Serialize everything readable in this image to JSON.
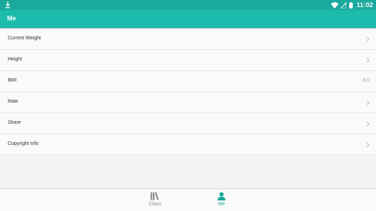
{
  "status_bar": {
    "time": "11:02",
    "icons": [
      "download-icon",
      "wifi-icon",
      "signal-icon",
      "battery-icon"
    ]
  },
  "app_bar": {
    "title": "Me"
  },
  "settings": {
    "items": [
      {
        "label": "Current Weight",
        "icon": "chevron-right-icon"
      },
      {
        "label": "Height",
        "icon": "chevron-right-icon"
      },
      {
        "label": "BMI",
        "value": "0.0"
      },
      {
        "label": "Rate",
        "icon": "chevron-right-icon"
      },
      {
        "label": "Share",
        "icon": "chevron-right-icon"
      },
      {
        "label": "Copyright Info",
        "icon": "chevron-right-icon"
      }
    ]
  },
  "bottom_nav": {
    "items": [
      {
        "label": "Class",
        "icon": "books-icon",
        "active": false
      },
      {
        "label": "Me",
        "icon": "person-icon",
        "active": true
      }
    ]
  },
  "colors": {
    "accent": "#1dbbad",
    "status_bar": "#1aa99c",
    "inactive": "#8a8a8a"
  }
}
